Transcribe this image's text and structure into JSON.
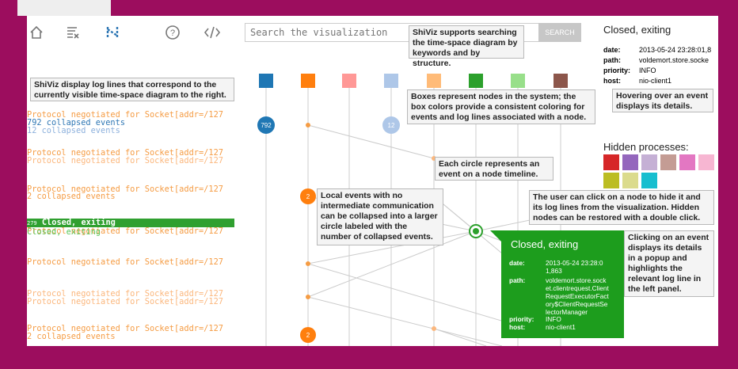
{
  "toolbar": {
    "icons": [
      "home-icon",
      "clear-icon",
      "structure-icon",
      "help-icon",
      "code-icon"
    ],
    "search_placeholder": "Search the visualization",
    "search_button": "SEARCH"
  },
  "callouts": {
    "search_info": "ShiViz supports searching the time-space diagram by keywords and by structure.",
    "log_lines": "ShiViz display log lines that correspond to the currently visible time-space diagram to the right.",
    "boxes": "Boxes represent nodes in the system; the box colors provide a consistent coloring for events and log lines associated with a node.",
    "hover": "Hovering over an event displays its details.",
    "circles": "Each circle represents an event on a node timeline.",
    "collapsed": "Local events with no intermediate communication can be collapsed into a larger circle labeled with the number of collapsed events.",
    "hide_node": "The user can click on a node to hide it and its log lines from the visualization. Hidden nodes can be restored with a double click.",
    "click_event": "Clicking on an event displays its details in a popup and highlights the relevant log line in the left panel."
  },
  "logs": [
    {
      "text": "Protocol negotiated for Socket[addr=/127",
      "tone": "o"
    },
    {
      "text": "792 collapsed events",
      "tone": "b"
    },
    {
      "text": "12 collapsed events",
      "tone": "lb"
    },
    {
      "text": "Protocol negotiated for Socket[addr=/127",
      "tone": "o"
    },
    {
      "text": "Protocol negotiated for Socket[addr=/127",
      "tone": "l"
    },
    {
      "text": "Protocol negotiated for Socket[addr=/127",
      "tone": "o"
    },
    {
      "text": "2 collapsed events",
      "tone": "o"
    },
    {
      "text": "Closed, exiting",
      "tone": "g"
    },
    {
      "text": "Protocol negotiated for Socket[addr=/127",
      "tone": "o"
    },
    {
      "text": "Protocol negotiated for Socket[addr=/127",
      "tone": "o"
    },
    {
      "text": "Protocol negotiated for Socket[addr=/127",
      "tone": "l"
    },
    {
      "text": "Protocol negotiated for Socket[addr=/127",
      "tone": "l"
    },
    {
      "text": "Protocol negotiated for Socket[addr=/127",
      "tone": "o"
    },
    {
      "text": "2 collapsed events",
      "tone": "o"
    }
  ],
  "highlight_log": {
    "count": "279",
    "text": "Closed, exiting"
  },
  "details": {
    "title": "Closed, exiting",
    "date_label": "date:",
    "date": "2013-05-24 23:28:01,8",
    "path_label": "path:",
    "path": "voldemort.store.socke",
    "priority_label": "priority:",
    "priority": "INFO",
    "host_label": "host:",
    "host": "nio-client1"
  },
  "hidden": {
    "title": "Hidden processes:",
    "colors": [
      "#d62728",
      "#9467bd",
      "#c5b0d5",
      "#c49c94",
      "#e377c2",
      "#f7b6d2",
      "#bcbd22",
      "#dbdb8d",
      "#17becf"
    ]
  },
  "nodes": [
    "#1f77b4",
    "#ff7f0e",
    "#ff9896",
    "#aec7e8",
    "#ffbb78",
    "#2ca02c",
    "#98df8a",
    "#8c564b"
  ],
  "circles": {
    "big1": "792",
    "big2": "12",
    "o1": "2",
    "o2": "2"
  },
  "popup": {
    "title": "Closed, exiting",
    "date_label": "date:",
    "date": "2013-05-24 23:28:0 1,863",
    "path_label": "path:",
    "path": "voldemort.store.sock et.clientrequest.Client RequestExecutorFact ory$ClientRequestSe lectorManager",
    "priority_label": "priority:",
    "priority": "INFO",
    "host_label": "host:",
    "host": "nio-client1"
  }
}
